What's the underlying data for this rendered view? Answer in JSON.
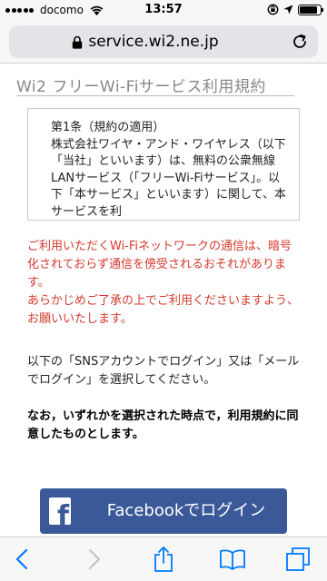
{
  "status_bar": {
    "carrier": "docomo",
    "time": "13:57",
    "battery_level": 0.85
  },
  "browser": {
    "url": "service.wi2.ne.jp",
    "accent_color": "#007aff"
  },
  "page": {
    "title": "Wi2 フリーWi-Fiサービス利用規約",
    "terms_text": "第1条（規約の適用）\n株式会社ワイヤ・アンド・ワイヤレス（以下「当社」といいます）は、無料の公衆無線LANサービス（「フリーWi-Fiサービス」。以下「本サービス」といいます）に関して、本サービスを利",
    "warning_1": "ご利用いただくWi-Fiネットワークの通信は、暗号化されておらず通信を傍受されるおそれがあります。",
    "warning_2": "あらかじめご了承の上でご利用くださいますよう、お願いいたします。",
    "instructions": "以下の「SNSアカウントでログイン」又は「メールでログイン」を選択してください。",
    "agreement_notice": "なお，いずれかを選択された時点で，利用規約に同意したものとします。",
    "facebook_button": "Facebookでログイン",
    "warning_color": "#d33a2c",
    "facebook_color": "#3b5998"
  }
}
